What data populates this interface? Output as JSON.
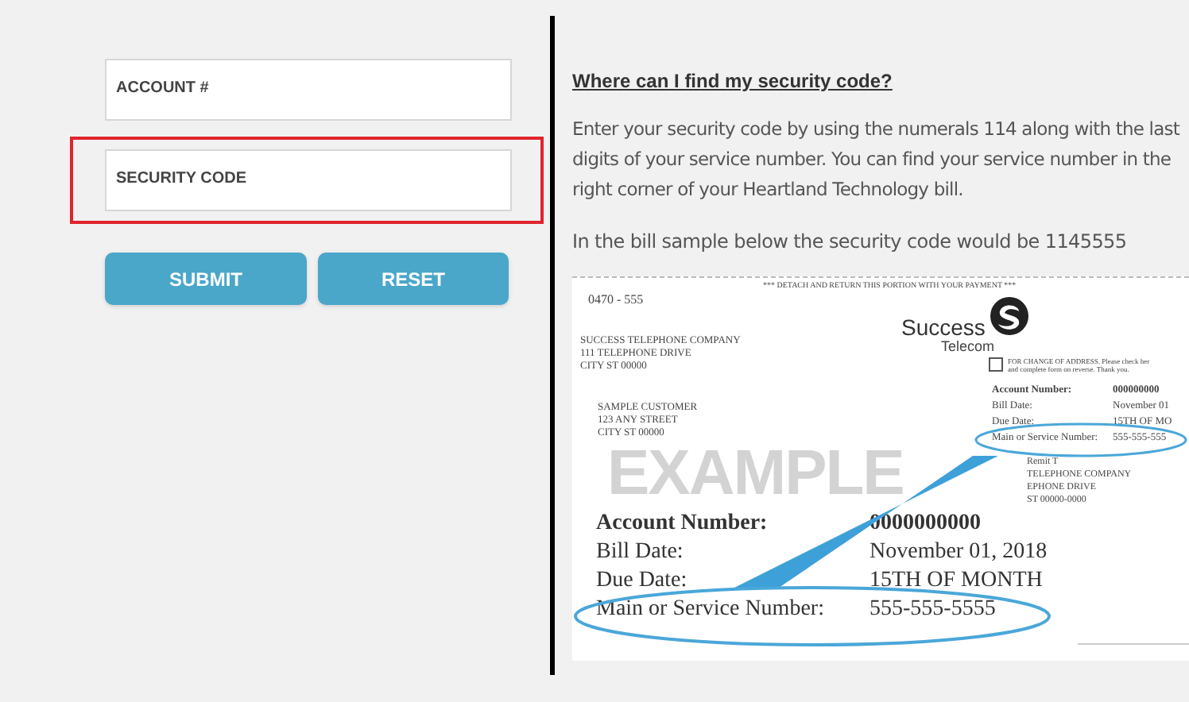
{
  "form": {
    "fields": [
      {
        "label": "ACCOUNT #",
        "highlighted": false
      },
      {
        "label": "SECURITY CODE",
        "highlighted": true
      }
    ],
    "buttons": [
      "SUBMIT",
      "RESET"
    ]
  },
  "help": {
    "heading": "Where can I find my security code?",
    "paragraph_lines": [
      "Enter your security code by using the numerals 114 along with the last",
      "digits of your service number. You can find your service number in the",
      "right corner of your Heartland Technology bill."
    ],
    "example_note": "In the bill sample below the security code would be 1145555",
    "bill": {
      "stub_code": "0470 - 555",
      "detach_notice": "*** DETACH AND RETURN THIS PORTION WITH YOUR PAYMENT ***",
      "logo_top": "Success",
      "logo_bottom": "Telecom",
      "company_lines": [
        "SUCCESS TELEPHONE COMPANY",
        "111 TELEPHONE DRIVE",
        "CITY  ST 00000"
      ],
      "address_change_checked": false,
      "address_change_lines": [
        "FOR CHANGE OF ADDRESS.  Please check her",
        "and complete form on reverse. Thank you."
      ],
      "summary_rows": [
        {
          "label": "Account Number:",
          "value": "000000000"
        },
        {
          "label": "Bill Date:",
          "value": "November 01"
        },
        {
          "label": "Due Date:",
          "value": "15TH OF MO"
        },
        {
          "label": "Main or Service Number:",
          "value": "555-555-555"
        }
      ],
      "customer_lines": [
        "SAMPLE CUSTOMER",
        "123 ANY STREET",
        "CITY  ST 00000"
      ],
      "watermark": "EXAMPLE",
      "remit_lines": [
        "Remit T",
        "TELEPHONE COMPANY",
        "EPHONE DRIVE",
        "ST 00000-0000"
      ],
      "detail_rows": [
        {
          "label": "Account Number:",
          "value": "0000000000"
        },
        {
          "label": "Bill Date:",
          "value": "November 01, 2018"
        },
        {
          "label": "Due Date:",
          "value": "15TH OF MONTH"
        },
        {
          "label": "Main or Service Number:",
          "value": "555-555-5555"
        }
      ]
    }
  }
}
